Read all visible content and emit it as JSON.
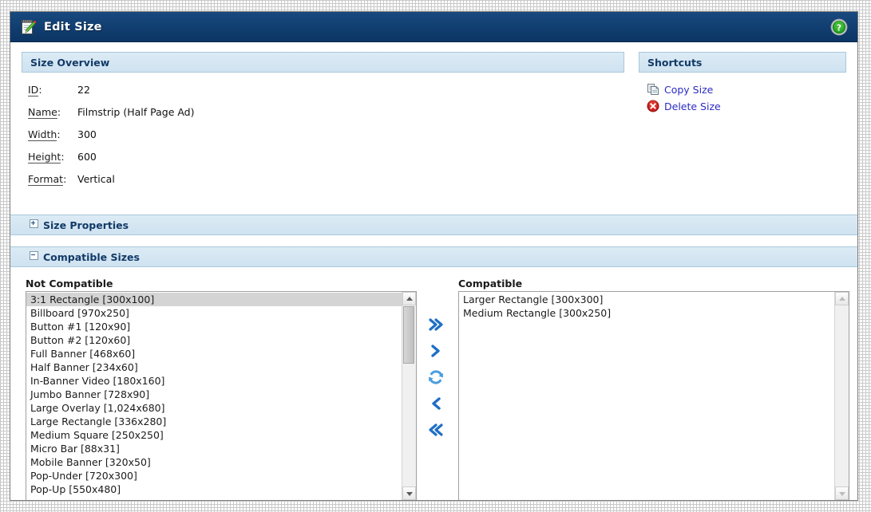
{
  "window": {
    "title": "Edit Size",
    "title_icon": "edit-note-icon",
    "help_icon": "help-question-icon"
  },
  "overview": {
    "heading": "Size Overview",
    "fields": [
      {
        "label": "ID",
        "value": "22"
      },
      {
        "label": "Name",
        "value": "Filmstrip (Half Page Ad)"
      },
      {
        "label": "Width",
        "value": "300"
      },
      {
        "label": "Height",
        "value": "600"
      },
      {
        "label": "Format",
        "value": "Vertical"
      }
    ]
  },
  "shortcuts": {
    "heading": "Shortcuts",
    "items": [
      {
        "label": "Copy Size",
        "icon": "copy-pages-icon"
      },
      {
        "label": "Delete Size",
        "icon": "delete-circle-icon"
      }
    ]
  },
  "size_properties": {
    "heading": "Size Properties",
    "state": "collapsed"
  },
  "compatible_sizes": {
    "heading": "Compatible Sizes",
    "state": "expanded",
    "not_compatible": {
      "label": "Not Compatible",
      "options": [
        "3:1 Rectangle [300x100]",
        "Billboard [970x250]",
        "Button #1 [120x90]",
        "Button #2 [120x60]",
        "Full Banner [468x60]",
        "Half Banner [234x60]",
        "In-Banner Video [180x160]",
        "Jumbo Banner [728x90]",
        "Large Overlay [1,024x680]",
        "Large Rectangle [336x280]",
        "Medium Square [250x250]",
        "Micro Bar [88x31]",
        "Mobile Banner [320x50]",
        "Pop-Under [720x300]",
        "Pop-Up [550x480]"
      ],
      "selected_index": 0
    },
    "compatible": {
      "label": "Compatible",
      "options": [
        "Larger Rectangle [300x300]",
        "Medium Rectangle [300x250]"
      ],
      "selected_index": -1
    },
    "transfer_buttons": [
      {
        "name": "move-all-right-button",
        "glyph": "»"
      },
      {
        "name": "move-right-button",
        "glyph": "›"
      },
      {
        "name": "refresh-button",
        "glyph": "↻"
      },
      {
        "name": "move-left-button",
        "glyph": "‹"
      },
      {
        "name": "move-all-left-button",
        "glyph": "«"
      }
    ]
  },
  "colors": {
    "titlebar": "#0e3d6e",
    "section_header_bg": "#d7e7f2",
    "section_header_text": "#123a68",
    "link": "#2b2bc4",
    "accent_blue": "#1f6fc4",
    "selected_row": "#d4d4d4"
  }
}
